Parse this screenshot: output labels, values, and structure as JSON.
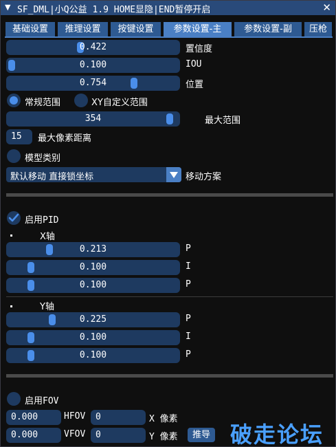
{
  "window": {
    "title": "SF_DML|小Q公益 1.9 HOME显隐|END暂停开启",
    "close_glyph": "✕",
    "collapse_glyph": "▼"
  },
  "tabs": [
    {
      "label": "基础设置",
      "active": false
    },
    {
      "label": "推理设置",
      "active": false
    },
    {
      "label": "按键设置",
      "active": false
    },
    {
      "label": "参数设置-主",
      "active": true
    },
    {
      "label": "参数设置-副",
      "active": false
    },
    {
      "label": "压枪",
      "active": false
    }
  ],
  "params": {
    "confidence": {
      "value": "0.422",
      "label": "置信度",
      "fraction": 0.42
    },
    "iou": {
      "value": "0.100",
      "label": "IOU",
      "fraction": 0.0
    },
    "position": {
      "value": "0.754",
      "label": "位置",
      "fraction": 0.75
    },
    "range_mode": {
      "normal_label": "常规范围",
      "custom_label": "XY自定义范围",
      "selected": "normal"
    },
    "max_range": {
      "value": "354",
      "label": "最大范围",
      "fraction": 0.97
    },
    "max_pixel_distance": {
      "value": "15",
      "label": "最大像素距离"
    },
    "model_category": {
      "label": "模型类别",
      "checked": false
    },
    "move_mode": {
      "value": "默认移动 直接锁坐标",
      "label": "移动方案"
    }
  },
  "pid": {
    "enable_label": "启用PID",
    "enabled": true,
    "x_axis": {
      "label": "X轴",
      "p": {
        "value": "0.213",
        "label": "P",
        "fraction": 0.23
      },
      "i": {
        "value": "0.100",
        "label": "I",
        "fraction": 0.12
      },
      "d": {
        "value": "0.100",
        "label": "P",
        "fraction": 0.12
      }
    },
    "y_axis": {
      "label": "Y轴",
      "p": {
        "value": "0.225",
        "label": "P",
        "fraction": 0.25
      },
      "i": {
        "value": "0.100",
        "label": "I",
        "fraction": 0.12
      },
      "d": {
        "value": "0.100",
        "label": "P",
        "fraction": 0.12
      }
    }
  },
  "fov": {
    "enable_label": "启用FOV",
    "enabled": false,
    "hfov": {
      "value": "0.000",
      "label": "HFOV"
    },
    "vfov": {
      "value": "0.000",
      "label": "VFOV"
    },
    "x_pixels": {
      "value": "0",
      "label": "X 像素"
    },
    "y_pixels": {
      "value": "0",
      "label": "Y 像素"
    },
    "derive_button": "推导"
  },
  "watermark": "破走论坛",
  "colors": {
    "title_bar": "#294a7a",
    "tab": "#2e5a92",
    "tab_active": "#4a7fc4",
    "frame": "#1e3a60",
    "accent": "#4a8eea",
    "watermark": "#4aa0ff"
  }
}
